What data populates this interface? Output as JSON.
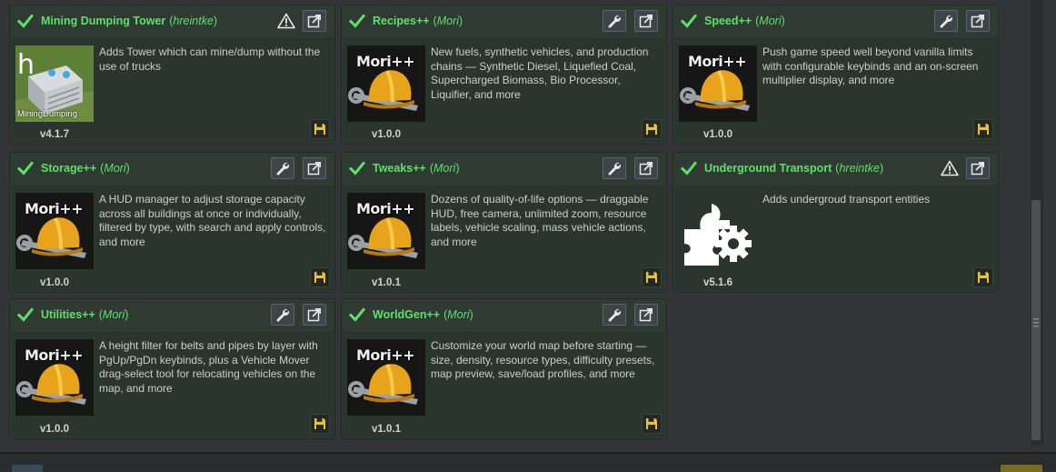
{
  "mods": [
    {
      "title": "Mining Dumping Tower",
      "author": "hreintke",
      "description": "Adds Tower which can mine/dump without the use of trucks",
      "version": "v4.1.7",
      "thumb": "mining",
      "thumb_text": "MiningDumping",
      "thumb_letter": "h",
      "warning": true,
      "settings": false
    },
    {
      "title": "Recipes++",
      "author": "Mori",
      "description": "New fuels, synthetic vehicles, and production chains — Synthetic Diesel, Liquefied Coal, Supercharged Biomass, Bio Processor, Liquifier, and more",
      "version": "v1.0.0",
      "thumb": "mori",
      "thumb_text": "Mori++",
      "warning": false,
      "settings": true
    },
    {
      "title": "Speed++",
      "author": "Mori",
      "description": "Push game speed well beyond vanilla limits with configurable keybinds and an on-screen multiplier display, and more",
      "version": "v1.0.0",
      "thumb": "mori",
      "thumb_text": "Mori++",
      "warning": false,
      "settings": true
    },
    {
      "title": "Storage++",
      "author": "Mori",
      "description": "A HUD manager to adjust storage capacity across all buildings at once or individually, filtered by type, with search and apply controls, and more",
      "version": "v1.0.0",
      "thumb": "mori",
      "thumb_text": "Mori++",
      "warning": false,
      "settings": true
    },
    {
      "title": "Tweaks++",
      "author": "Mori",
      "description": "Dozens of quality-of-life options — draggable HUD, free camera, unlimited zoom, resource labels, vehicle scaling, mass vehicle actions, and more",
      "version": "v1.0.1",
      "thumb": "mori",
      "thumb_text": "Mori++",
      "warning": false,
      "settings": true
    },
    {
      "title": "Underground Transport",
      "author": "hreintke",
      "description": "Adds undergroud transport entities",
      "version": "v5.1.6",
      "thumb": "puzzle",
      "warning": true,
      "settings": false
    },
    {
      "title": "Utilities++",
      "author": "Mori",
      "description": "A height filter for belts and pipes by layer with PgUp/PgDn keybinds, plus a Vehicle Mover drag-select tool for relocating vehicles on the map, and more",
      "version": "v1.0.0",
      "thumb": "mori",
      "thumb_text": "Mori++",
      "warning": false,
      "settings": true
    },
    {
      "title": "WorldGen++",
      "author": "Mori",
      "description": "Customize your world map before starting — size, density, resource types, difficulty presets, map preview, save/load profiles, and more",
      "version": "v1.0.1",
      "thumb": "mori",
      "thumb_text": "Mori++",
      "warning": false,
      "settings": true
    }
  ],
  "colors": {
    "title_green": "#5ee06a",
    "save_icon": "#e8c23a",
    "card_bg": "#2b3530"
  },
  "icons": {
    "enabled": "check-icon",
    "warning": "warning-triangle-icon",
    "settings": "wrench-icon",
    "open": "external-link-icon",
    "save": "save-floppy-icon"
  }
}
